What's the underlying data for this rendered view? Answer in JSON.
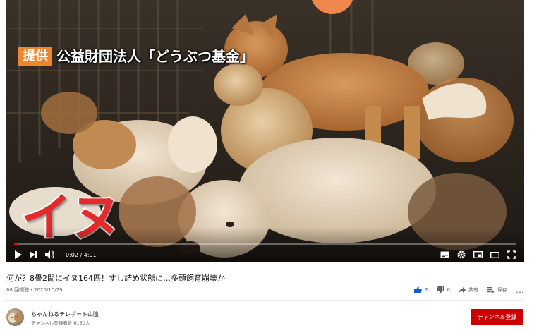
{
  "video": {
    "caption_badge": "提供",
    "caption_text": "公益財団法人「どうぶつ基金」",
    "overlay_label": "イヌ",
    "progress_fraction": 0.008,
    "time_display": "0:02 / 4:01"
  },
  "info": {
    "title": "何が？8畳2間にイヌ164匹！すし詰め状態に…多頭飼育崩壊か",
    "views_date": "88 回視聴・2020/10/29",
    "like_count": "2",
    "dislike_count": "0",
    "share_label": "共有",
    "save_label": "保存",
    "more_label": "…"
  },
  "channel": {
    "name": "ちゃんねるテレポート山陰",
    "subscribers": "チャンネル登録者数 6150人",
    "subscribe_label": "チャンネル登録"
  },
  "colors": {
    "accent": "#ff0000",
    "like_active": "#065fd4",
    "subscribe": "#cc0000",
    "caption_badge": "#f0862c"
  }
}
